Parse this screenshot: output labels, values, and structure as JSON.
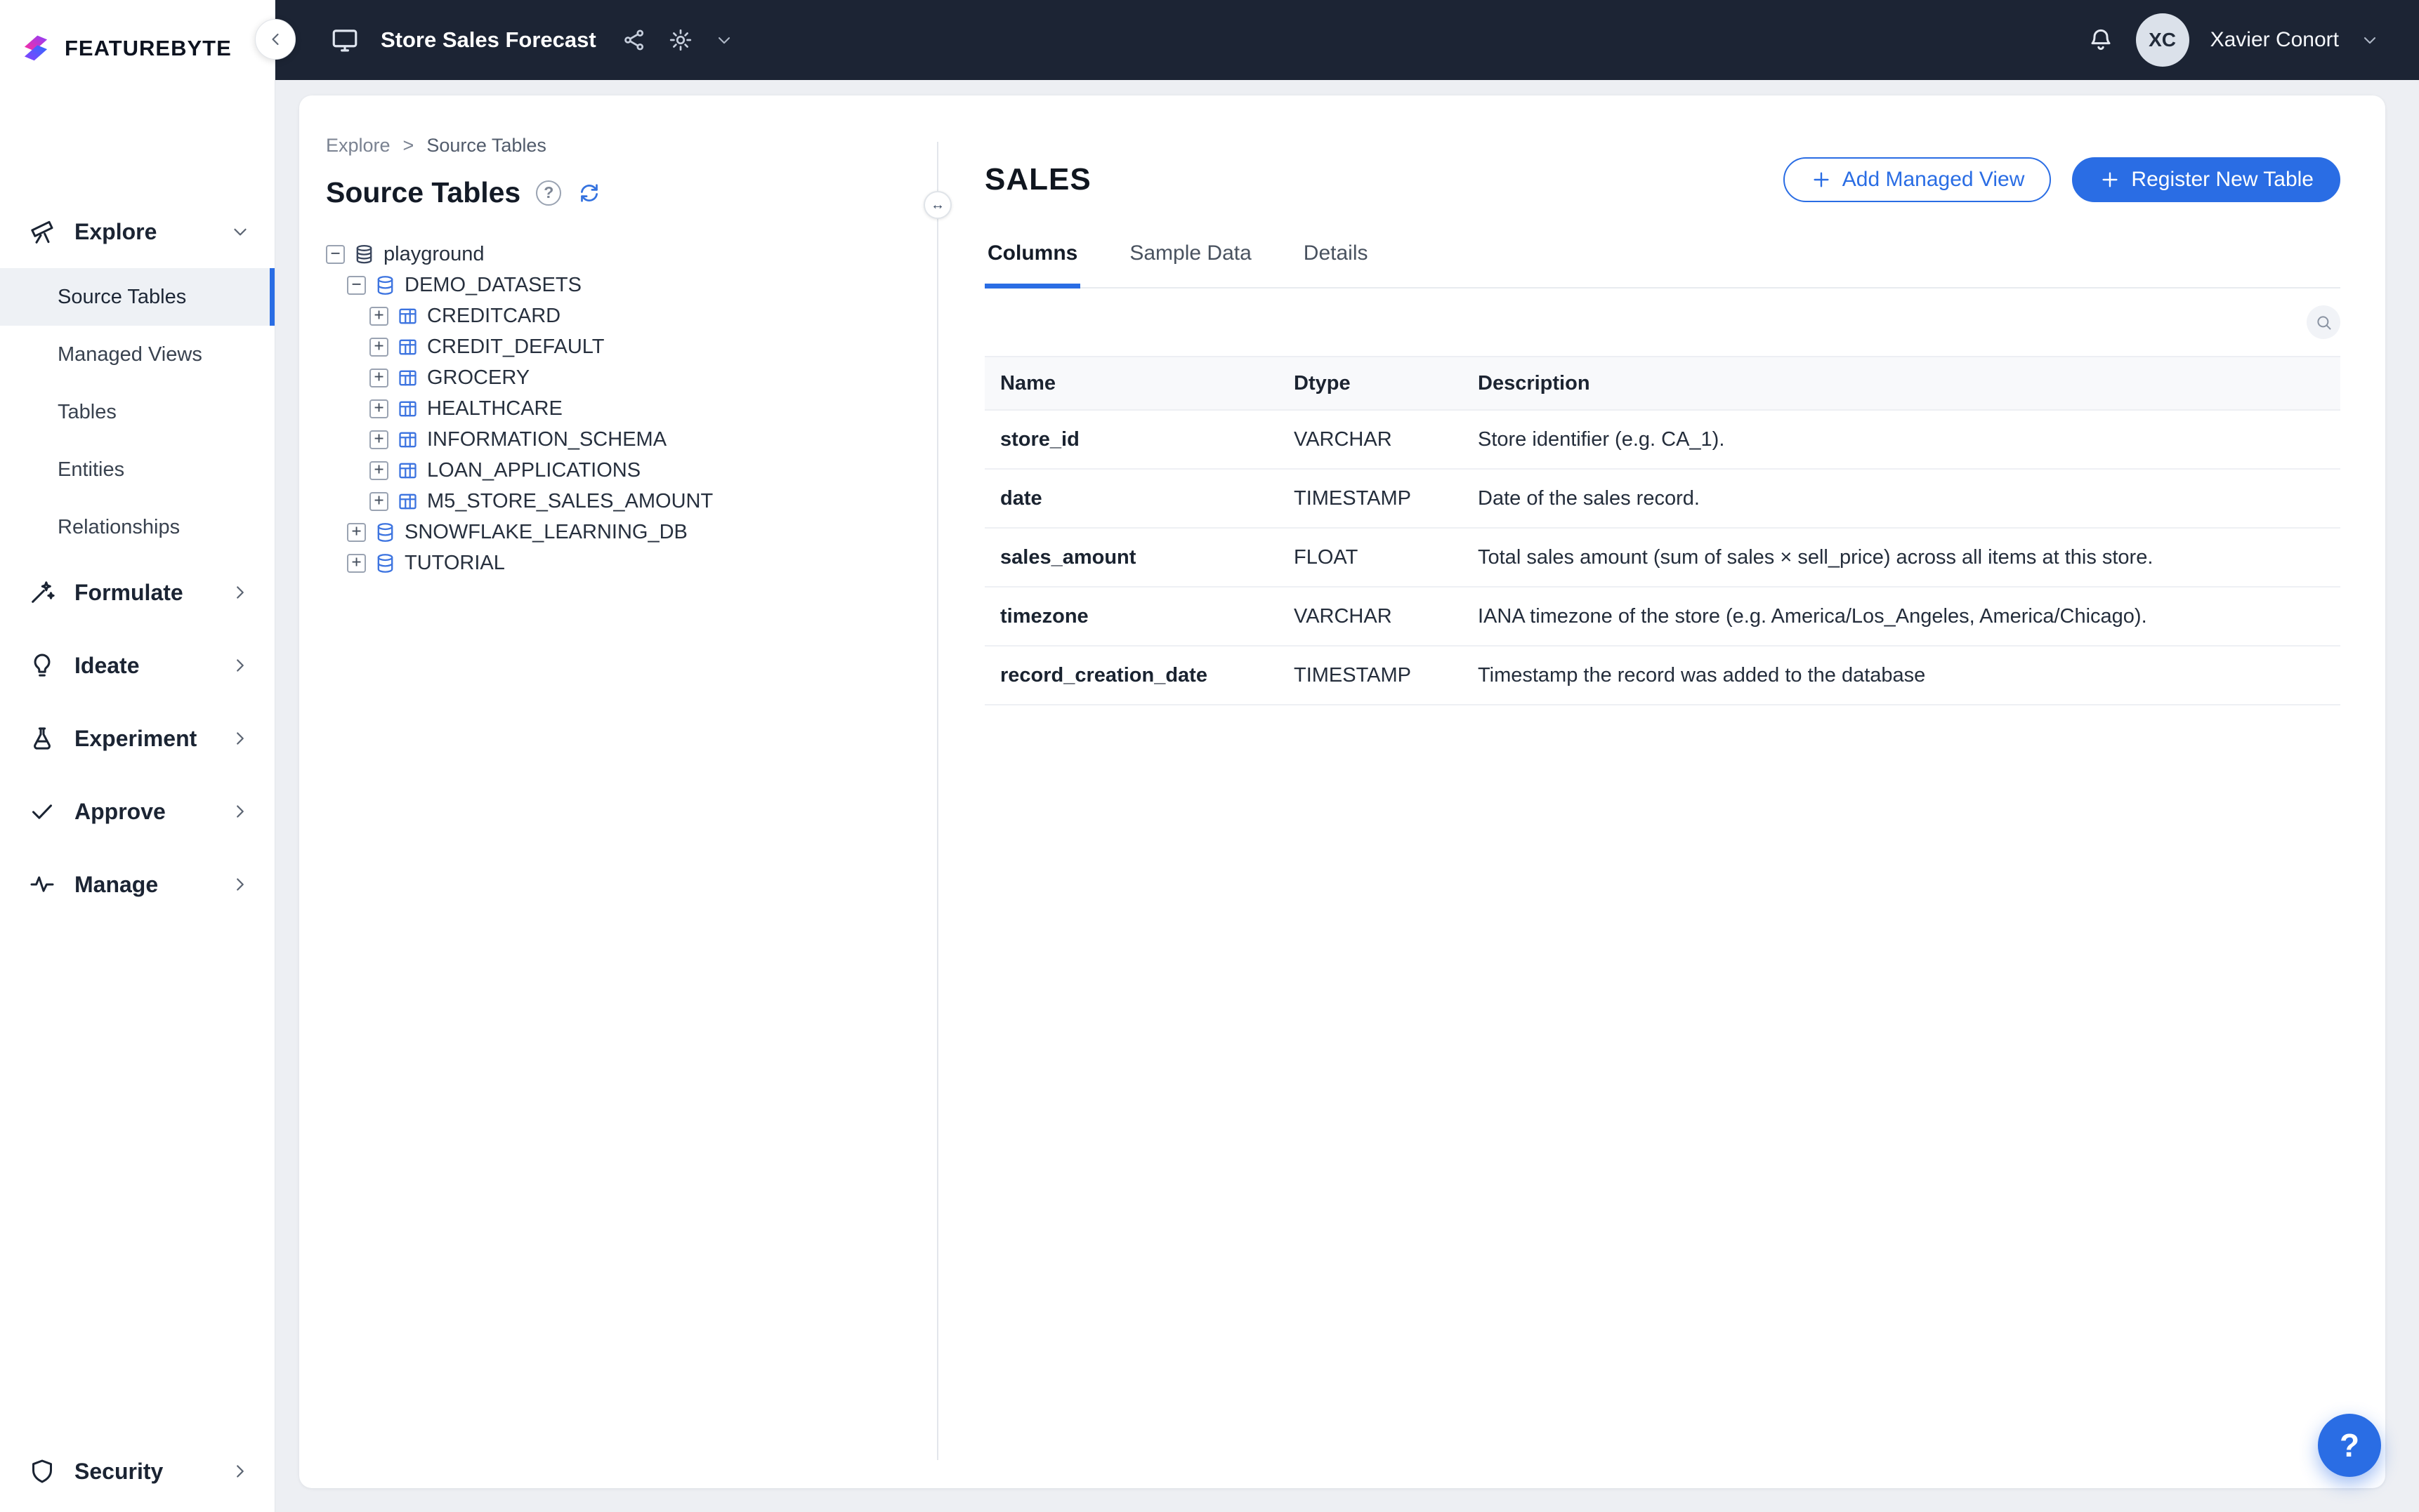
{
  "colors": {
    "accent": "#2a6de4",
    "topbar": "#1c2434"
  },
  "brand": {
    "logo_text_bold": "FEATURE",
    "logo_text_light": "BYTE"
  },
  "icons": {
    "help_glyph": "?",
    "resize_glyph": "↔"
  },
  "topbar": {
    "project_title": "Store Sales Forecast",
    "user_initials": "XC",
    "user_name": "Xavier Conort"
  },
  "sidebar": {
    "explore": {
      "label": "Explore"
    },
    "explore_children": [
      {
        "label": "Source Tables"
      },
      {
        "label": "Managed Views"
      },
      {
        "label": "Tables"
      },
      {
        "label": "Entities"
      },
      {
        "label": "Relationships"
      }
    ],
    "sections": [
      {
        "label": "Formulate"
      },
      {
        "label": "Ideate"
      },
      {
        "label": "Experiment"
      },
      {
        "label": "Approve"
      },
      {
        "label": "Manage"
      }
    ],
    "bottom": {
      "label": "Security"
    }
  },
  "breadcrumb": {
    "items": [
      "Explore",
      "Source Tables"
    ],
    "separator": ">"
  },
  "tree_panel": {
    "title": "Source Tables",
    "nodes": [
      {
        "label": "playground",
        "toggle": "−"
      },
      {
        "label": "DEMO_DATASETS",
        "toggle": "−"
      },
      {
        "label": "CREDITCARD",
        "toggle": "+"
      },
      {
        "label": "CREDIT_DEFAULT",
        "toggle": "+"
      },
      {
        "label": "GROCERY",
        "toggle": "+"
      },
      {
        "label": "HEALTHCARE",
        "toggle": "+"
      },
      {
        "label": "INFORMATION_SCHEMA",
        "toggle": "+"
      },
      {
        "label": "LOAN_APPLICATIONS",
        "toggle": "+"
      },
      {
        "label": "M5_STORE_SALES_AMOUNT",
        "toggle": "+"
      },
      {
        "label": "SNOWFLAKE_LEARNING_DB",
        "toggle": "+"
      },
      {
        "label": "TUTORIAL",
        "toggle": "+"
      }
    ]
  },
  "detail": {
    "title": "SALES",
    "actions": [
      {
        "label": "Add Managed View"
      },
      {
        "label": "Register New Table"
      }
    ],
    "tabs": [
      {
        "label": "Columns"
      },
      {
        "label": "Sample Data"
      },
      {
        "label": "Details"
      }
    ],
    "table": {
      "headers": [
        "Name",
        "Dtype",
        "Description"
      ],
      "rows": [
        {
          "name": "store_id",
          "dtype": "VARCHAR",
          "description": "Store identifier (e.g. CA_1)."
        },
        {
          "name": "date",
          "dtype": "TIMESTAMP",
          "description": "Date of the sales record."
        },
        {
          "name": "sales_amount",
          "dtype": "FLOAT",
          "description": "Total sales amount (sum of sales × sell_price) across all items at this store."
        },
        {
          "name": "timezone",
          "dtype": "VARCHAR",
          "description": "IANA timezone of the store (e.g. America/Los_Angeles, America/Chicago)."
        },
        {
          "name": "record_creation_date",
          "dtype": "TIMESTAMP",
          "description": "Timestamp the record was added to the database"
        }
      ]
    }
  },
  "help_button": {
    "label": "?"
  }
}
